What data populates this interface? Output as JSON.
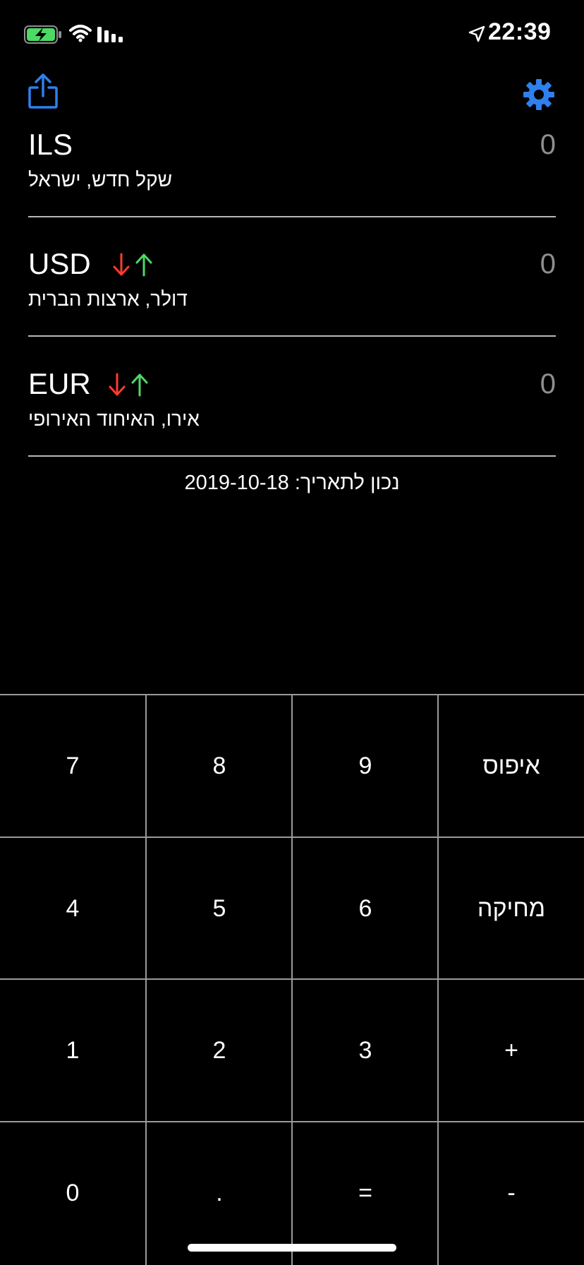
{
  "status_bar": {
    "time": "22:39",
    "icons": [
      "battery-charging-icon",
      "wifi-icon",
      "signal-icon",
      "location-arrow-icon"
    ]
  },
  "toolbar": {
    "icons": [
      "share-icon",
      "gear-icon"
    ],
    "accent_color": "#2f80ed"
  },
  "currencies": [
    {
      "code": "ILS",
      "name": "שקל חדש, ישראל",
      "value": "0",
      "has_rate_arrows": false
    },
    {
      "code": "USD",
      "name": "דולר, ארצות הברית",
      "value": "0",
      "has_rate_arrows": true
    },
    {
      "code": "EUR",
      "name": "אירו, האיחוד האירופי",
      "value": "0",
      "has_rate_arrows": true
    }
  ],
  "rate_arrow_colors": {
    "down": "#ff3b30",
    "up": "#4cd964"
  },
  "rate_date": "נכון לתאריך: 2019-10-18",
  "keypad": {
    "rows": [
      [
        "7",
        "8",
        "9",
        "איפוס"
      ],
      [
        "4",
        "5",
        "6",
        "מחיקה"
      ],
      [
        "1",
        "2",
        "3",
        "+"
      ],
      [
        "0",
        ".",
        "=",
        "-"
      ]
    ]
  }
}
